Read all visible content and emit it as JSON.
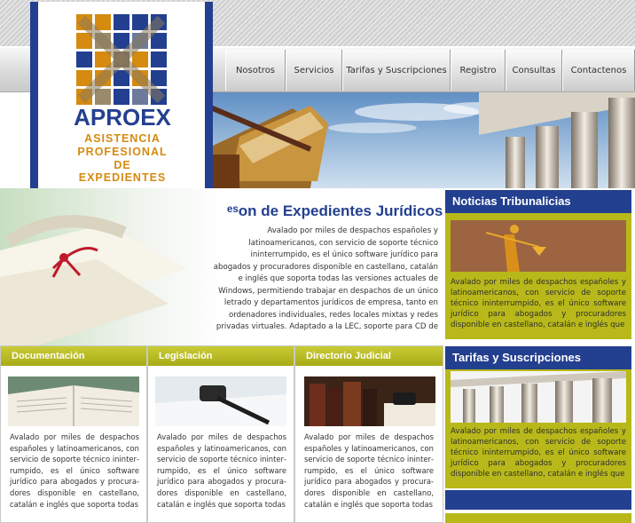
{
  "brand": {
    "name": "APROEX",
    "tagline_lines": [
      "ASISTENCIA",
      "PROFESIONAL",
      "DE EXPEDIENTES"
    ],
    "colors": {
      "blue": "#233f8f",
      "gold": "#d68a10",
      "olive": "#b8b81a"
    }
  },
  "nav": {
    "items": [
      {
        "label": "Nosotros"
      },
      {
        "label": "Servicios"
      },
      {
        "label": "Tarifas y Suscripciones"
      },
      {
        "label": "Registro"
      },
      {
        "label": "Consultas"
      },
      {
        "label": "Contactenos"
      }
    ]
  },
  "feature": {
    "title": "ᵉˢon de Expedientes Jurídicos",
    "text": "Avalado por miles de despachos españoles y latinoamerica­nos, con servicio de soporte técnico ininterrumpido, es el único software jurídico para abogados y procuradores disponible en castellano, catalán e inglés que soporta todas las versiones actuales de Windows, permitiendo trabajar en despachos de un único letrado y departamentos jurídicos de empresa, tanto en ordenadores individuales, redes locales mixtas y redes privadas virtuales. Adaptado a la LEC, soporte para CD de vistas judiciales, integración con Microsoft Office e internet, agendas Pocket PC, y un largo etcétera de caracter-"
  },
  "sidebar": {
    "news": {
      "title": "Noticias Tribunalicias",
      "text": "Avalado por miles de despachos españoles y latinoamericanos, con servicio de soporte técnico ininterrumpido, es el único software jurídico para abogados y procuradores disponible en castellano, catalán e inglés que"
    },
    "rates": {
      "title": "Tarifas y Suscripciones",
      "text": "Avalado por miles de despachos españoles y latinoamericanos, con servicio de soporte técnico ininterrumpido, es el único software jurídico para abogados y procuradores disponible en castellano, catalán e inglés que"
    }
  },
  "cards": [
    {
      "title": "Documentación",
      "text": "Avalado por miles de despachos españoles y latinoamericanos, con servicio de soporte técnico ininter­rumpido, es el único software jurídico para abogados y procura­dores disponible en castellano, catalán e inglés que soporta todas"
    },
    {
      "title": "Legislación",
      "text": "Avalado por miles de despachos españoles y latinoamericanos, con servicio de soporte técnico ininter­rumpido, es el único software jurídico para abogados y procura­dores disponible en castellano, catalán e inglés que soporta todas"
    },
    {
      "title": "Directorio Judicial",
      "text": "Avalado por miles de despachos españoles y latinoamericanos, con servicio de soporte técnico ininter­rumpido, es el único software jurídico para abogados y procura­dores disponible en castellano, catalán e inglés que soporta todas"
    }
  ]
}
